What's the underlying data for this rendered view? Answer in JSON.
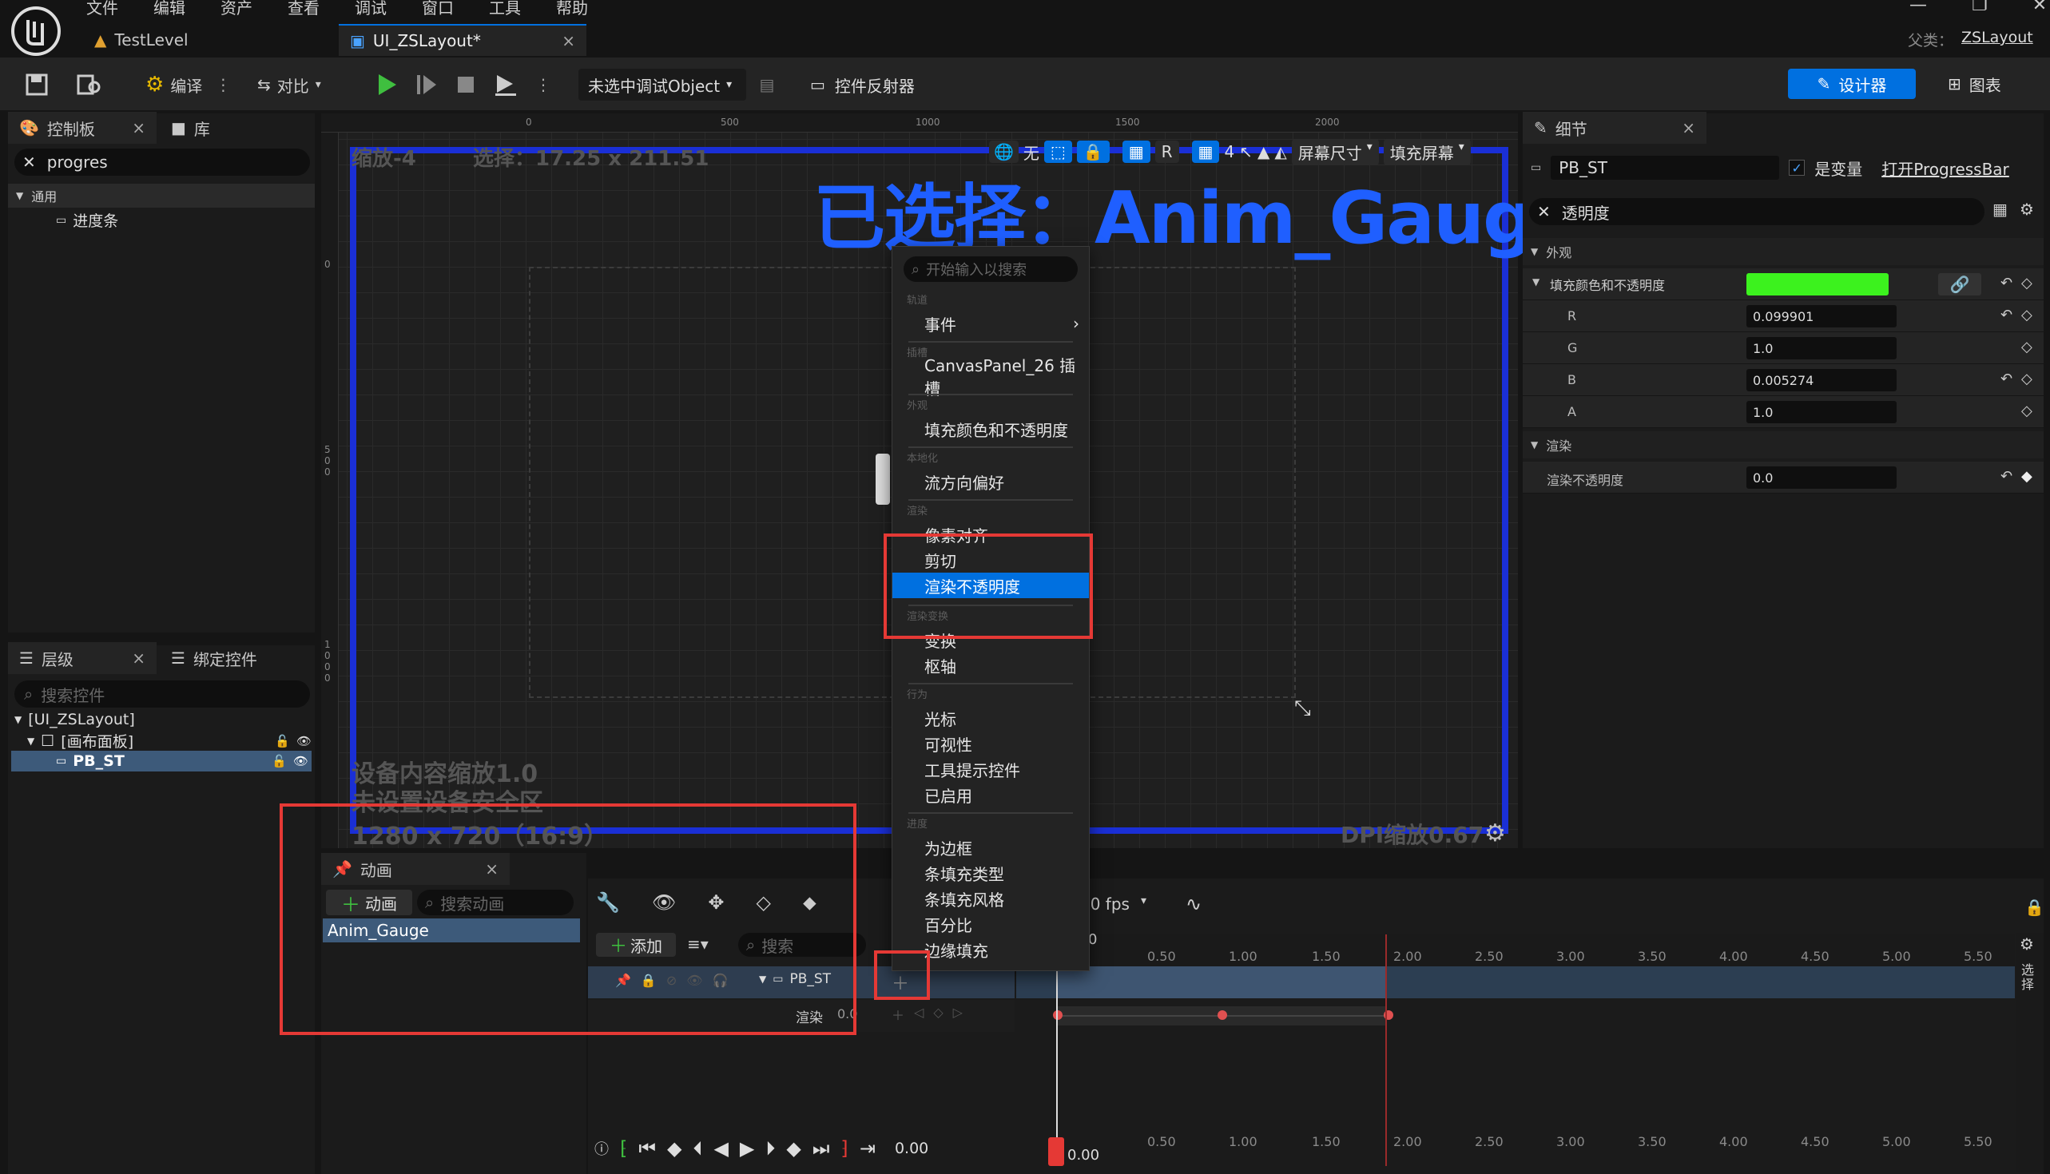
{
  "menu": {
    "items": [
      "文件",
      "编辑",
      "资产",
      "查看",
      "调试",
      "窗口",
      "工具",
      "帮助"
    ]
  },
  "tabs": {
    "level": "TestLevel",
    "widget": "UI_ZSLayout*",
    "close": "×"
  },
  "parent": {
    "label": "父类：",
    "value": "ZSLayout"
  },
  "toolbar": {
    "compile": "编译",
    "diff": "对比",
    "debug_object": "未选中调试Object",
    "reflector": "控件反射器",
    "designer": "设计器",
    "graph": "图表"
  },
  "palette": {
    "tab": "控制板",
    "library_tab": "库",
    "search_value": "progres",
    "category": "通用",
    "item": "进度条",
    "close": "×"
  },
  "hierarchy": {
    "tab": "层级",
    "bind_tab": "绑定控件",
    "search_placeholder": "搜索控件",
    "root": "[UI_ZSLayout]",
    "canvas": "[画布面板]",
    "item": "PB_ST",
    "close": "×"
  },
  "viewport": {
    "zoom": "缩放-4",
    "selection": "选择：17.25 x 211.51",
    "selected": "已选择：Anim_Gauge",
    "ruler": [
      "0",
      "500",
      "1000",
      "1500",
      "2000"
    ],
    "ruler_v": [
      "0",
      "5\n0\n0",
      "1\n0\n0\n0"
    ],
    "no_label": "无",
    "r_label": "R",
    "grid_num": "4",
    "screen_size": "屏幕尺寸",
    "fill_screen": "填充屏幕",
    "device_scale": "设备内容缩放1.0",
    "safe_zone": "未设置设备安全区",
    "resolution": "1280 x 720（16:9）",
    "dpi": "DPI缩放0.67"
  },
  "context_menu": {
    "search_placeholder": "开始输入以搜索",
    "sections": [
      {
        "header": "轨道",
        "items": [
          "事件"
        ]
      },
      {
        "header": "插槽",
        "items": [
          "CanvasPanel_26 插槽"
        ]
      },
      {
        "header": "外观",
        "items": [
          "填充颜色和不透明度"
        ]
      },
      {
        "header": "本地化",
        "items": [
          "流方向偏好"
        ]
      },
      {
        "header": "渲染",
        "items": [
          "像素对齐",
          "剪切",
          "渲染不透明度"
        ]
      },
      {
        "header": "渲染变换",
        "items": [
          "变换",
          "枢轴"
        ]
      },
      {
        "header": "行为",
        "items": [
          "光标",
          "可视性",
          "工具提示控件",
          "已启用"
        ]
      },
      {
        "header": "进度",
        "items": [
          "为边框",
          "条填充类型",
          "条填充风格",
          "百分比",
          "边缘填充"
        ]
      }
    ],
    "highlighted": "渲染不透明度"
  },
  "animation": {
    "tab": "动画",
    "add_anim": "动画",
    "search_placeholder": "搜索动画",
    "selected": "Anim_Gauge",
    "close": "×"
  },
  "sequencer": {
    "fps": "20 fps",
    "add": "添加",
    "search_placeholder": "搜索",
    "track": "PB_ST",
    "subtrack": "渲染",
    "subtrack_value": "0.0",
    "time": "0.00",
    "playhead": "0.00",
    "ticks": [
      "0.50",
      "1.00",
      "1.50",
      "2.00",
      "2.50",
      "3.00",
      "3.50",
      "4.00",
      "4.50",
      "5.00",
      "5.50"
    ],
    "top_zero": "0",
    "side_label": "选择"
  },
  "details": {
    "tab": "细节",
    "name": "PB_ST",
    "is_variable": "是变量",
    "open": "打开ProgressBar",
    "search_value": "透明度",
    "section_appearance": "外观",
    "fill_color": "填充颜色和不透明度",
    "fill_color_hex": "#3cf21e",
    "r_label": "R",
    "r": "0.099901",
    "g_label": "G",
    "g": "1.0",
    "b_label": "B",
    "b": "0.005274",
    "a_label": "A",
    "a": "1.0",
    "section_render": "渲染",
    "render_opacity": "渲染不透明度",
    "render_opacity_value": "0.0",
    "close": "×"
  },
  "colors": {
    "accent": "#0070e0",
    "selected_text": "#1f5fff",
    "highlight_box": "#e53935",
    "viewport_border": "#1a2fd6",
    "green": "#3cf21e"
  }
}
